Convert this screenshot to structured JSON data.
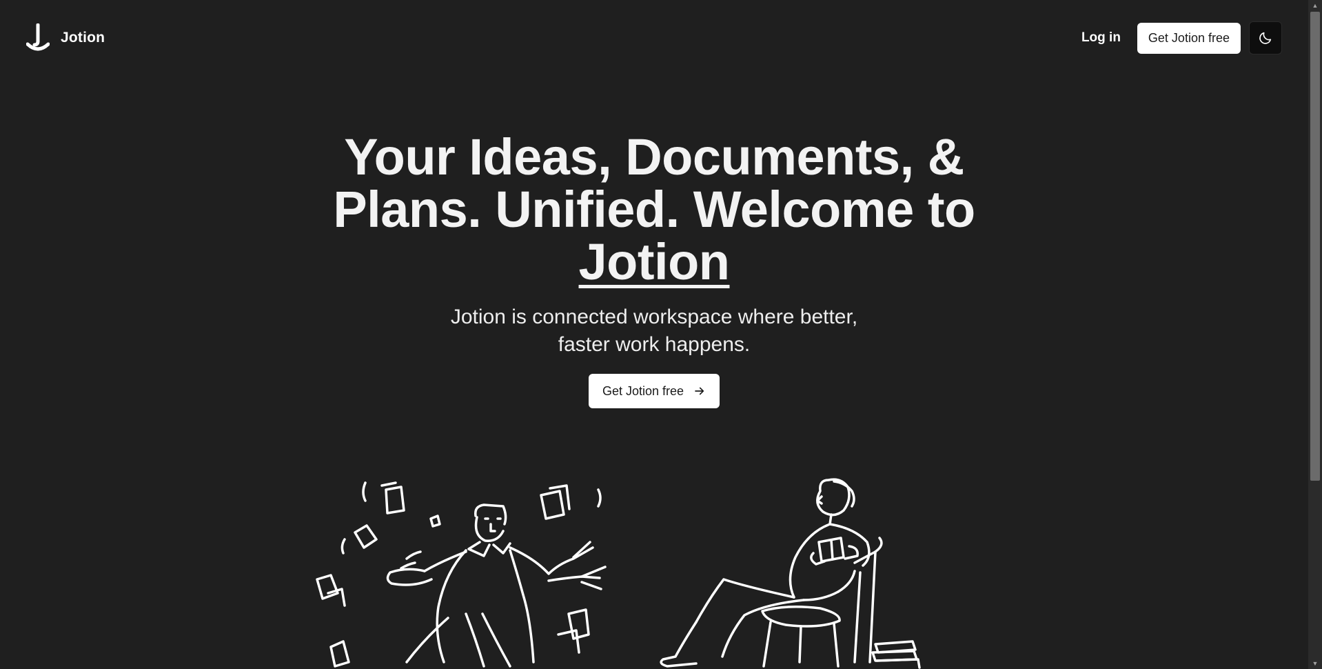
{
  "navbar": {
    "brand_name": "Jotion",
    "login_label": "Log in",
    "cta_label": "Get Jotion free",
    "theme_icon": "moon-icon"
  },
  "hero": {
    "headline_main": "Your Ideas, Documents, & Plans. Unified. Welcome to ",
    "headline_brand": "Jotion",
    "subheadline": "Jotion is connected workspace where better, faster work happens.",
    "cta_label": "Get Jotion free",
    "cta_icon": "arrow-right-icon"
  },
  "illustrations": {
    "left": "person-throwing-papers-illustration",
    "right": "person-reading-in-chair-illustration"
  },
  "colors": {
    "background": "#1f1f1f",
    "text": "#f5f5f5",
    "button_bg": "#ffffff",
    "button_text": "#1a1a1a",
    "toggle_bg": "#0e0e0e"
  }
}
